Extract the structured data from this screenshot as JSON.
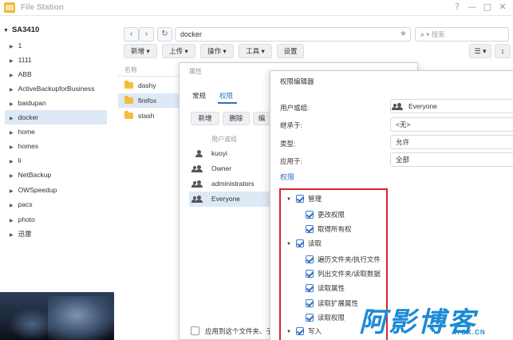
{
  "window": {
    "title": "File Station",
    "help": "?",
    "minimize": "—",
    "maximize": "□",
    "close": "✕"
  },
  "sidebar": {
    "root": "SA3410",
    "items": [
      {
        "label": "1"
      },
      {
        "label": "1111"
      },
      {
        "label": "ABB"
      },
      {
        "label": "ActiveBackupforBusiness"
      },
      {
        "label": "baidupan"
      },
      {
        "label": "docker"
      },
      {
        "label": "home"
      },
      {
        "label": "homes"
      },
      {
        "label": "li"
      },
      {
        "label": "NetBackup"
      },
      {
        "label": "OWSpeedup"
      },
      {
        "label": "pacs"
      },
      {
        "label": "photo"
      },
      {
        "label": "迅雷"
      }
    ]
  },
  "toolbar": {
    "back": "‹",
    "forward": "›",
    "refresh": "↻",
    "path": "docker",
    "star": "★",
    "search_placeholder": "搜索",
    "search_icon": "⌕",
    "create": "新增 ▾",
    "upload": "上传 ▾",
    "action": "操作 ▾",
    "tools": "工具 ▾",
    "settings": "设置",
    "view_list": "☰ ▾",
    "more": "↕"
  },
  "file_list": {
    "col_name": "名称",
    "rows": [
      {
        "name": "dashy"
      },
      {
        "name": "firefox"
      },
      {
        "name": "stash"
      }
    ]
  },
  "properties": {
    "title": "属性",
    "tabs": {
      "general": "常规",
      "permission": "权限"
    },
    "buttons": {
      "add": "新增",
      "delete": "删除",
      "edit": "编"
    },
    "col_user": "用户或组",
    "users": [
      {
        "name": "kuoyi"
      },
      {
        "name": "Owner"
      },
      {
        "name": "administrators"
      },
      {
        "name": "Everyone"
      }
    ],
    "footer": "应用到这个文件夹、子"
  },
  "perm_editor": {
    "title": "权限编辑器",
    "labels": {
      "user": "用户或组:",
      "inherit": "继承于:",
      "type": "类型:",
      "apply": "应用于:"
    },
    "values": {
      "user": "Everyone",
      "inherit": "<无>",
      "type": "允许",
      "apply": "全部"
    },
    "section": "权限",
    "groups": {
      "admin": "管理",
      "change_perm": "更改权限",
      "take_owner": "取得所有权",
      "read": "读取",
      "traverse": "遍历文件夹/执行文件",
      "list": "列出文件夹/读取数据",
      "read_attr": "读取属性",
      "read_ext": "读取扩展属性",
      "read_perm": "读取权限",
      "write": "写入"
    }
  },
  "watermark": {
    "main": "阿影博客",
    "sub": "AYBK.CN"
  }
}
